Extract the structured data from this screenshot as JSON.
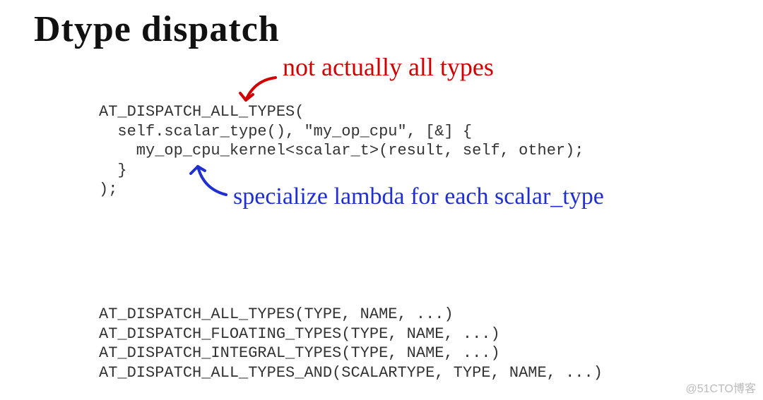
{
  "title": "Dtype dispatch",
  "annotations": {
    "red": "not actually all types",
    "blue": "specialize lambda for each scalar_type"
  },
  "code_block_1": "AT_DISPATCH_ALL_TYPES(\n  self.scalar_type(), \"my_op_cpu\", [&] {\n    my_op_cpu_kernel<scalar_t>(result, self, other);\n  }\n);",
  "code_block_2": "AT_DISPATCH_ALL_TYPES(TYPE, NAME, ...)\nAT_DISPATCH_FLOATING_TYPES(TYPE, NAME, ...)\nAT_DISPATCH_INTEGRAL_TYPES(TYPE, NAME, ...)\nAT_DISPATCH_ALL_TYPES_AND(SCALARTYPE, TYPE, NAME, ...)",
  "watermark": "@51CTO博客",
  "colors": {
    "red": "#d00000",
    "blue": "#2030d0",
    "text": "#333333"
  }
}
